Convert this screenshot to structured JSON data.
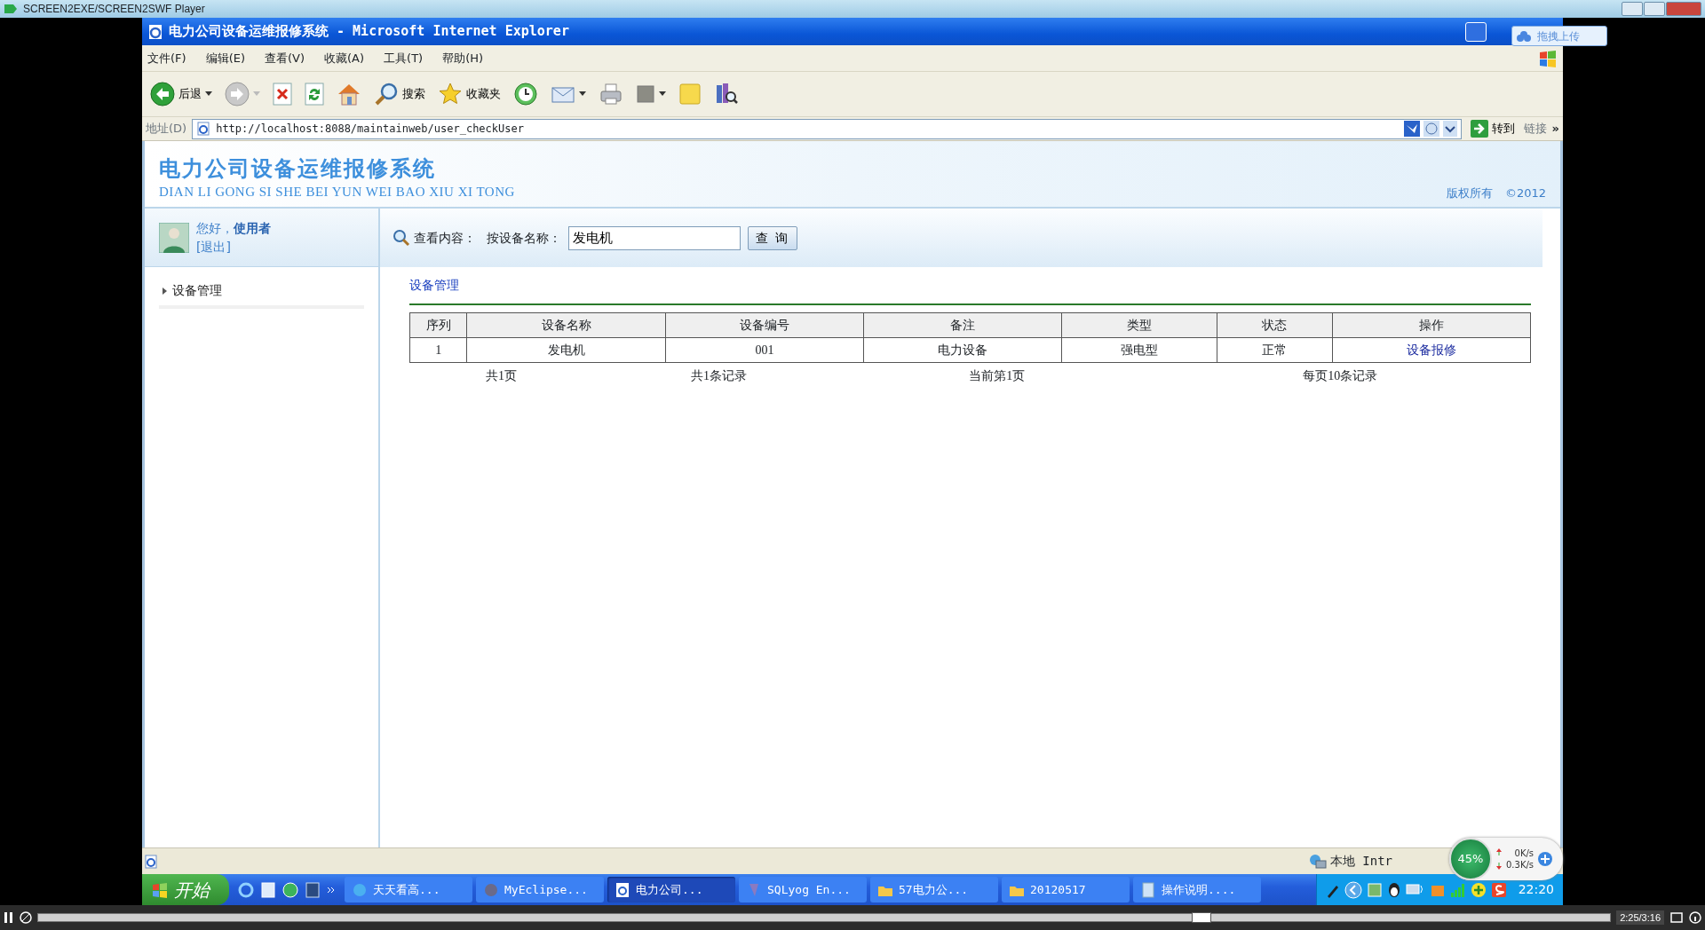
{
  "player": {
    "title": "SCREEN2EXE/SCREEN2SWF Player",
    "progress": {
      "level": 0.74
    },
    "time": "2:25/3:16"
  },
  "browser": {
    "title": "电力公司设备运维报修系统 - Microsoft Internet Explorer",
    "menu": [
      "文件(F)",
      "编辑(E)",
      "查看(V)",
      "收藏(A)",
      "工具(T)",
      "帮助(H)"
    ],
    "toolbar": [
      {
        "kind": "back",
        "label": "后退"
      },
      {
        "kind": "forward"
      },
      {
        "kind": "stop"
      },
      {
        "kind": "refresh"
      },
      {
        "kind": "home"
      },
      {
        "kind": "search",
        "label": "搜索"
      },
      {
        "kind": "favorites",
        "label": "收藏夹"
      },
      {
        "kind": "history"
      },
      {
        "kind": "mail"
      },
      {
        "kind": "print"
      },
      {
        "kind": "edit"
      },
      {
        "kind": "notes"
      },
      {
        "kind": "research"
      }
    ],
    "address_label": "地址(D)",
    "url": "http://localhost:8088/maintainweb/user_checkUser",
    "go": "转到",
    "links": "链接",
    "links_more": "»",
    "upload_widget": "拖拽上传",
    "status_zone": "本地 Intr"
  },
  "page": {
    "title": "电力公司设备运维报修系统",
    "subtitle": "DIAN LI GONG SI SHE BEI YUN WEI BAO XIU XI TONG",
    "copyright": "版权所有",
    "year": "©2012",
    "greeting": "您好，**使用者**",
    "logout": "[退出]",
    "nav": [
      {
        "label": "设备管理"
      }
    ],
    "search": {
      "label": "查看内容：",
      "field_label": "按设备名称：",
      "value": "发电机",
      "button": "查 询"
    },
    "section": "设备管理",
    "table": {
      "columns": [
        "序列",
        "设备名称",
        "设备编号",
        "备注",
        "类型",
        "状态",
        "操作"
      ],
      "rows": [
        {
          "cells": [
            "1",
            "发电机",
            "001",
            "电力设备",
            "强电型",
            "正常"
          ],
          "action": "设备报修"
        }
      ]
    },
    "pager": [
      "共1页",
      "共1条记录",
      "当前第1页",
      "每页10条记录"
    ]
  },
  "monitor": {
    "percent": "45%",
    "up": "0K/s",
    "down": "0.3K/s"
  },
  "taskbar": {
    "start": "开始",
    "tasks": [
      {
        "label": "天天看高...",
        "kind": "player",
        "selected": false
      },
      {
        "label": "MyEclipse...",
        "kind": "eclipse",
        "selected": false
      },
      {
        "label": "电力公司...",
        "kind": "ie",
        "selected": true
      },
      {
        "label": "SQLyog En...",
        "kind": "db",
        "selected": false
      },
      {
        "label": "57电力公...",
        "kind": "folder",
        "selected": false
      },
      {
        "label": "20120517",
        "kind": "folder",
        "selected": false
      },
      {
        "label": "操作说明....",
        "kind": "doc",
        "selected": false
      }
    ],
    "clock": "22:20"
  }
}
